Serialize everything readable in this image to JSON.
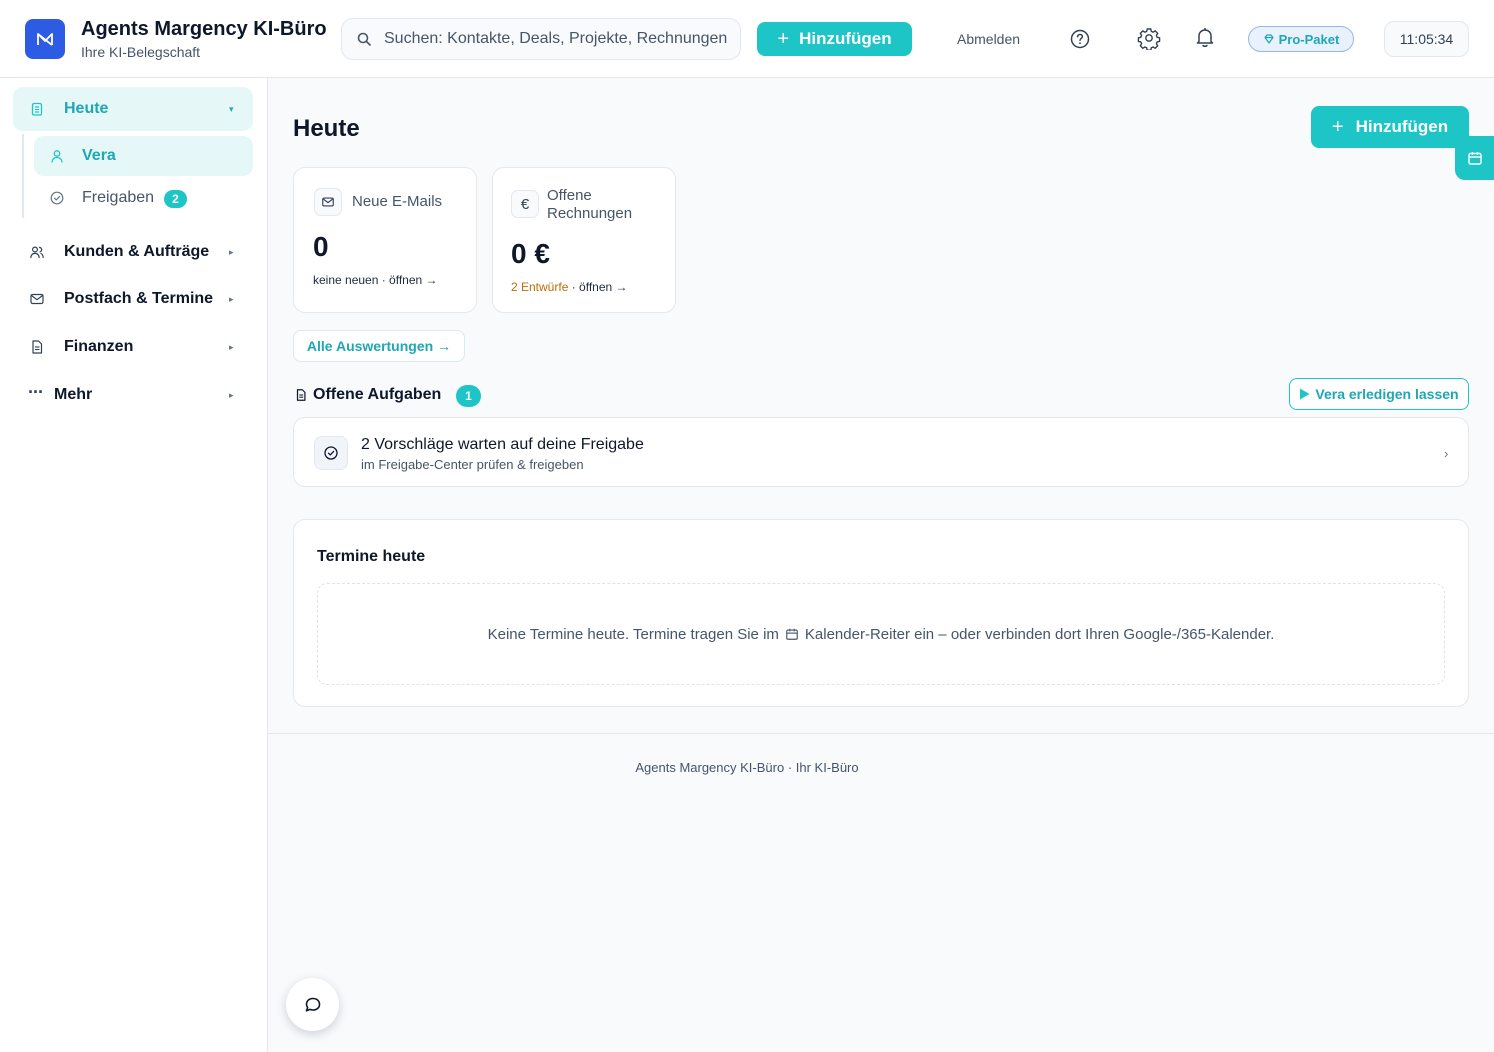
{
  "header": {
    "app_title": "Agents Margency KI-Büro",
    "app_subtitle": "Ihre KI-Belegschaft",
    "search_placeholder": "Suchen: Kontakte, Deals, Projekte, Rechnungen",
    "add_label": "Hinzufügen",
    "logout_label": "Abmelden",
    "plan_label": "Pro-Paket",
    "clock": "11:05:34",
    "icons": [
      "logo-icon",
      "search-icon",
      "plus-icon",
      "help-icon",
      "gear-icon",
      "bell-icon",
      "gem-icon"
    ]
  },
  "sidebar": {
    "heute": {
      "label": "Heute",
      "icon": "clipboard-icon",
      "expanded": true
    },
    "sub_items": [
      {
        "label": "Vera",
        "icon": "user-icon",
        "active": true
      },
      {
        "label": "Freigaben",
        "icon": "check-circle-icon",
        "badge": "2"
      }
    ],
    "items": [
      {
        "label": "Kunden & Aufträge",
        "icon": "users-icon"
      },
      {
        "label": "Postfach & Termine",
        "icon": "mail-icon"
      },
      {
        "label": "Finanzen",
        "icon": "document-icon"
      },
      {
        "label": "Mehr",
        "icon": "more-icon"
      }
    ]
  },
  "main": {
    "title": "Heute",
    "add_label": "Hinzufügen",
    "stats": [
      {
        "label": "Neue E-Mails",
        "value": "0",
        "foot_prefix": "",
        "foot_text": "keine neuen · öffnen →",
        "icon": "mail-icon"
      },
      {
        "label": "Offene Rechnungen",
        "value": "0 €",
        "foot_prefix": "2 Entwürfe",
        "foot_text": " · öffnen →",
        "icon": "euro-icon"
      }
    ],
    "all_reports_label": "Alle Auswertungen →",
    "tasks": {
      "title": "Offene Aufgaben",
      "count": "1",
      "action_label": "Vera erledigen lassen",
      "items": [
        {
          "title": "2 Vorschläge warten auf deine Freigabe",
          "subtitle": "im Freigabe-Center prüfen & freigeben"
        }
      ]
    },
    "appointments": {
      "title": "Termine heute",
      "empty_before": "Keine Termine heute. Termine tragen Sie im",
      "empty_after": "Kalender-Reiter ein – oder verbinden dort Ihren Google-/365-Kalender."
    },
    "footer": "Agents Margency KI-Büro · Ihr KI-Büro"
  },
  "colors": {
    "accent": "#1ec5c7",
    "accent_text": "#1ea7b5",
    "logo_bg": "#2d5be3",
    "active_bg": "#e6f7f8",
    "warning_text": "#b86e0a"
  }
}
